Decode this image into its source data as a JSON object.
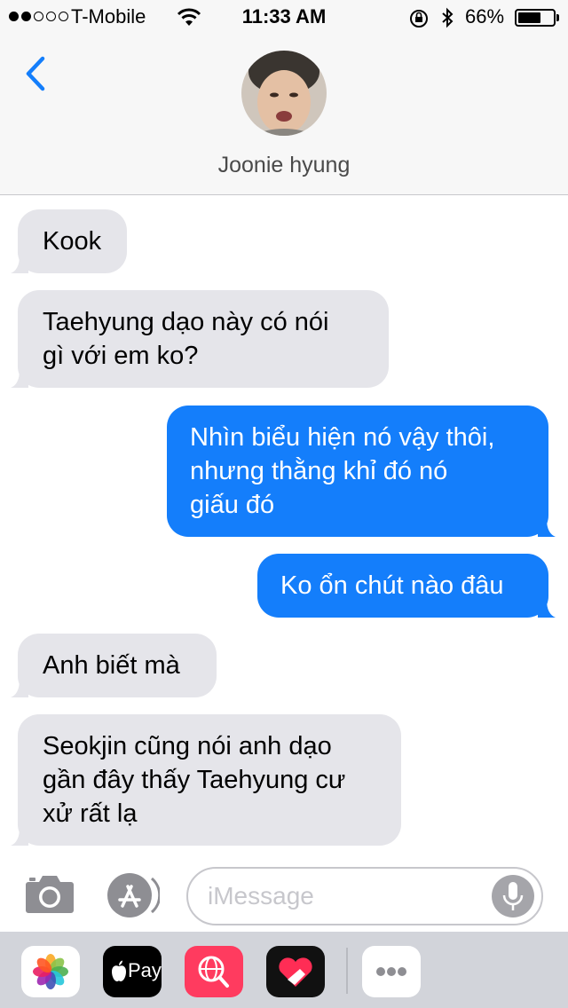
{
  "status_bar": {
    "carrier": "T-Mobile",
    "time": "11:33 AM",
    "battery": "66%",
    "signal_bars": 2,
    "battery_level": 0.66
  },
  "header": {
    "contact_name": "Joonie hyung"
  },
  "messages": [
    {
      "direction": "incoming",
      "lines": [
        "Kook"
      ]
    },
    {
      "direction": "incoming",
      "lines": [
        "Taehyung dạo này có nói",
        "gì với em ko?"
      ]
    },
    {
      "direction": "outgoing",
      "lines": [
        "Nhìn biểu hiện nó vậy thôi,",
        "nhưng thằng khỉ đó nó",
        "giấu đó"
      ]
    },
    {
      "direction": "outgoing",
      "lines": [
        "Ko ổn chút nào đâu"
      ]
    },
    {
      "direction": "incoming",
      "lines": [
        "Anh biết mà"
      ]
    },
    {
      "direction": "incoming",
      "lines": [
        "Seokjin cũng nói anh dạo",
        "gần đây thấy Taehyung cư",
        "xử rất lạ"
      ]
    }
  ],
  "composer": {
    "placeholder": "iMessage"
  },
  "app_tray": {
    "apple_pay_label": "Pay"
  },
  "colors": {
    "outgoing": "#147efb",
    "incoming": "#e5e5ea",
    "accent": "#147efb"
  }
}
